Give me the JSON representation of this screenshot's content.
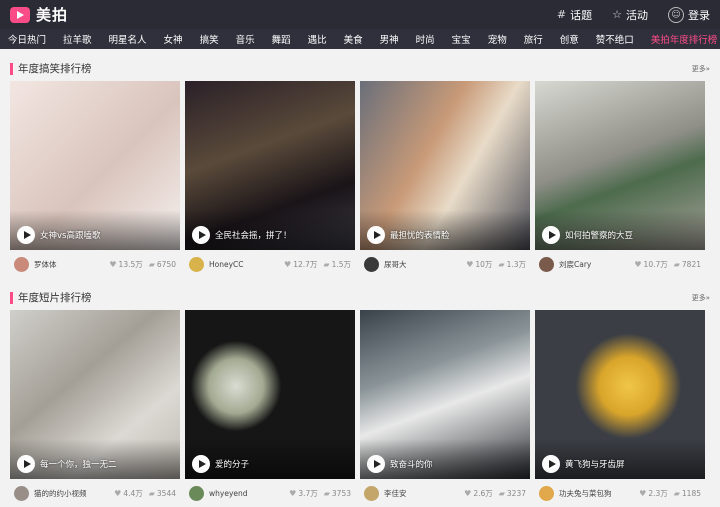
{
  "app": {
    "name": "美拍"
  },
  "top": {
    "topics": "话题",
    "events": "活动",
    "login": "登录"
  },
  "categories": [
    "今日热门",
    "拉羊歌",
    "明星名人",
    "女神",
    "搞笑",
    "音乐",
    "舞蹈",
    "遇比",
    "美食",
    "男神",
    "时尚",
    "宝宝",
    "宠物",
    "旅行",
    "创意",
    "赞不绝口",
    "美拍年度排行榜"
  ],
  "sections": [
    {
      "title": "年度搞笑排行榜",
      "more": "更多»",
      "cards": [
        {
          "caption": "女神vs高跟嗑歌",
          "author": "罗体体",
          "likes": "13.5万",
          "comments": "6750",
          "bg": "linear-gradient(135deg,#f3e6e2,#d9c4bc 55%,#f5f0ee)",
          "avatar": "#c98a7a"
        },
        {
          "caption": "全民社会摇，拼了！",
          "author": "HoneyCC",
          "likes": "12.7万",
          "comments": "1.5万",
          "bg": "linear-gradient(160deg,#2a2028,#5a4a3a 40%,#1a1418 70%,#3b3b44)",
          "avatar": "#d8b24a"
        },
        {
          "caption": "最担忧的表情脸",
          "author": "尿哥大",
          "likes": "10万",
          "comments": "1.3万",
          "bg": "linear-gradient(120deg,#6a6f7a,#c89a78 40%,#e8dbc8 60%,#4a4c55)",
          "avatar": "#3a3a3a"
        },
        {
          "caption": "如何拍警察的大豆",
          "author": "刘宸Cary",
          "likes": "10.7万",
          "comments": "7821",
          "bg": "linear-gradient(160deg,#d8d8d2,#8f8f88 45%,#4d6b4d 60%,#a7a39a)",
          "avatar": "#7a5a4a"
        }
      ]
    },
    {
      "title": "年度短片排行榜",
      "more": "更多»",
      "cards": [
        {
          "caption": "每一个你，独一无二",
          "author": "猫的的约小视频",
          "likes": "4.4万",
          "comments": "3544",
          "bg": "linear-gradient(140deg,#d0cfcb,#a49f96 40%,#dcd9d4 70%,#bdb8b0)",
          "avatar": "#9a8f88"
        },
        {
          "caption": "爱的分子",
          "author": "whyeyend",
          "likes": "3.7万",
          "comments": "3753",
          "bg": "radial-gradient(circle at 30% 45%,#d8ddd2 0,#a3aa92 18%,#161616 30%),#111",
          "avatar": "#6a8a5a"
        },
        {
          "caption": "致奋斗的你",
          "author": "李佳安",
          "likes": "2.6万",
          "comments": "3237",
          "bg": "linear-gradient(160deg,#39424a,#8a9498 35%,#e8e8e8 55%,#2a2f33)",
          "avatar": "#c4a56a"
        },
        {
          "caption": "黄飞狗与牙齿屏",
          "author": "功夫兔与菜包狗",
          "likes": "2.3万",
          "comments": "1185",
          "bg": "radial-gradient(circle at 55% 45%,#f0c648 0,#d9a52b 22%,#3b3e45 40%),#2f3137",
          "avatar": "#e0a84a"
        }
      ]
    }
  ],
  "colors": {
    "accent": "#fc4c87",
    "topbar": "#2b2b36",
    "catbar": "#30303d"
  }
}
